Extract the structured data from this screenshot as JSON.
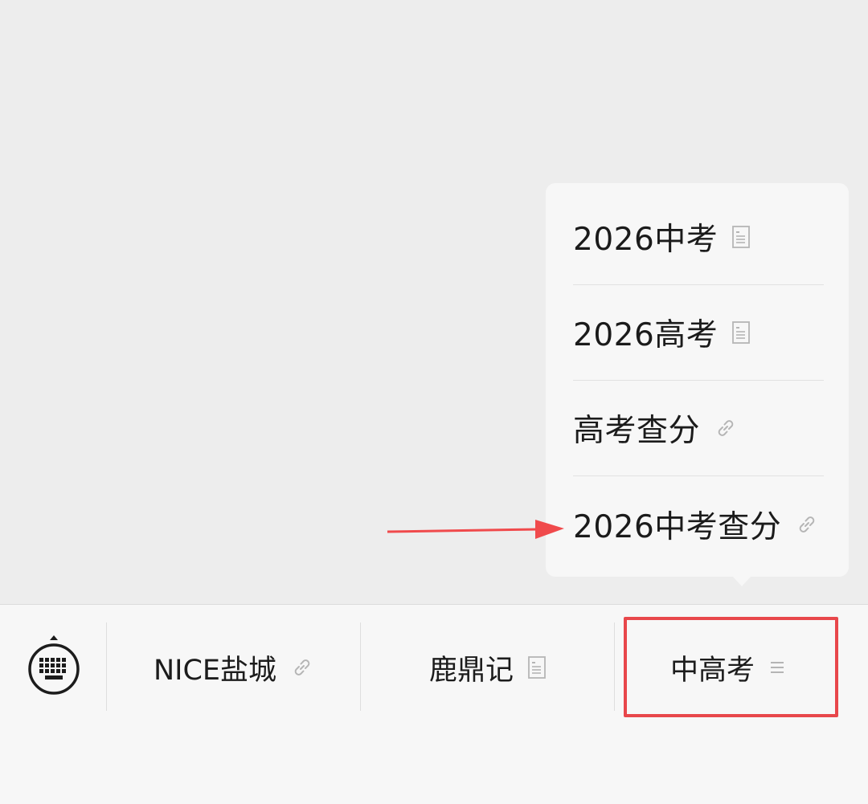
{
  "popup": {
    "items": [
      {
        "label": "2026中考",
        "icon": "document-icon"
      },
      {
        "label": "2026高考",
        "icon": "document-icon"
      },
      {
        "label": "高考查分",
        "icon": "link-icon"
      },
      {
        "label": "2026中考查分",
        "icon": "link-icon"
      }
    ]
  },
  "menu_bar": {
    "keyboard_icon": "keyboard-icon",
    "tabs": [
      {
        "label": "NICE盐城",
        "icon": "link-icon"
      },
      {
        "label": "鹿鼎记",
        "icon": "document-icon"
      },
      {
        "label": "中高考",
        "icon": "submenu-icon"
      }
    ]
  },
  "colors": {
    "background": "#ededed",
    "menu_background": "#f7f7f7",
    "highlight": "#e8474b",
    "arrow": "#f04a4c",
    "icon_gray": "#b5b5b5"
  }
}
